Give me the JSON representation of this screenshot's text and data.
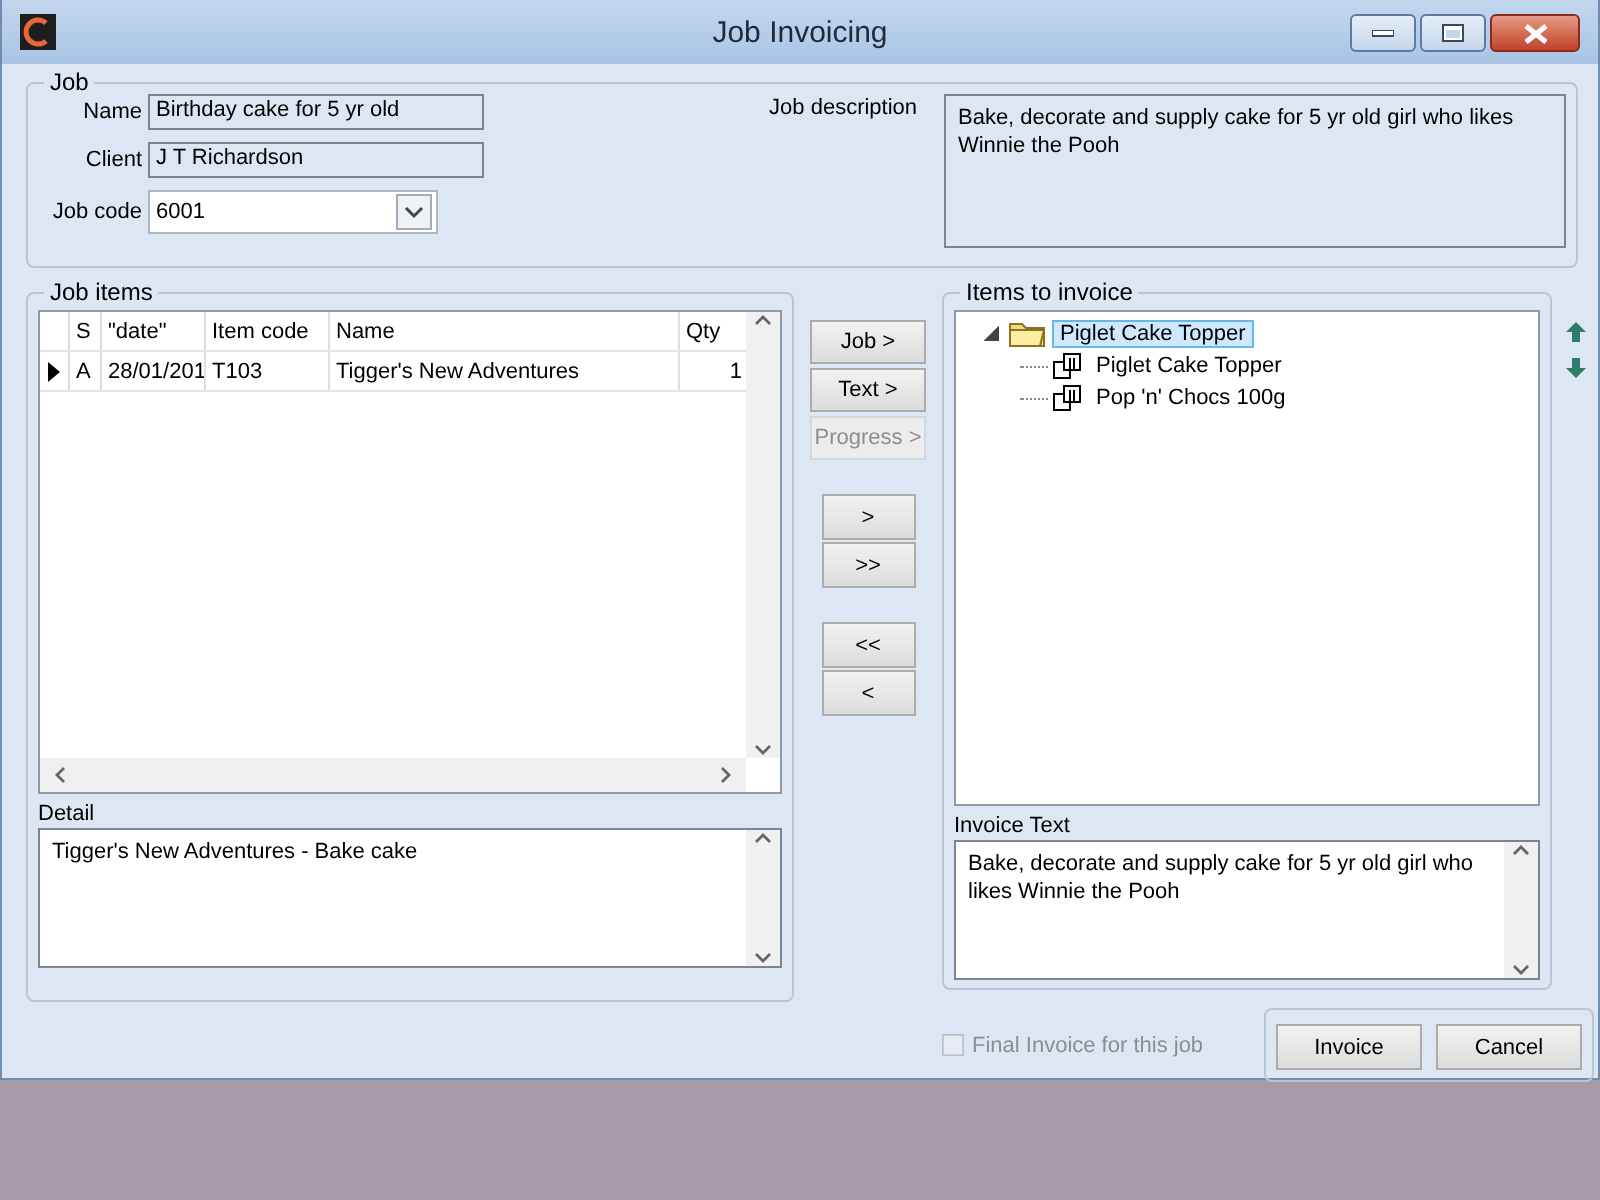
{
  "window": {
    "title": "Job Invoicing"
  },
  "job": {
    "title": "Job",
    "name_label": "Name",
    "name": "Birthday cake for 5 yr old",
    "client_label": "Client",
    "client": "J T Richardson",
    "code_label": "Job code",
    "code": "6001",
    "description_label": "Job description",
    "description": "Bake, decorate and supply cake for 5 yr old girl who likes Winnie the Pooh"
  },
  "job_items": {
    "title": "Job items",
    "columns": [
      "S",
      "\"date\"",
      "Item code",
      "Name",
      "Qty"
    ],
    "rows": [
      {
        "current": true,
        "cells": [
          "A",
          "28/01/201",
          "T103",
          "Tigger's New Adventures",
          "1"
        ]
      }
    ],
    "detail_label": "Detail",
    "detail": "Tigger's New Adventures - Bake cake"
  },
  "transfer_buttons": [
    {
      "label": "Job >",
      "disabled": false
    },
    {
      "label": "Text >",
      "disabled": false
    },
    {
      "label": "Progress >",
      "disabled": true
    }
  ],
  "move_buttons": [
    {
      "label": ">"
    },
    {
      "label": ">>"
    },
    {
      "label": "<<"
    },
    {
      "label": "<"
    }
  ],
  "items_to_invoice": {
    "title": "Items to invoice",
    "tree": [
      {
        "label": "Piglet Cake Topper",
        "expanded": true,
        "selected": true,
        "children": [
          {
            "label": "Piglet Cake Topper",
            "selected": false
          },
          {
            "label": "Pop 'n' Chocs 100g",
            "selected": false
          }
        ]
      }
    ],
    "invoice_text_label": "Invoice Text",
    "invoice_text": "Bake, decorate and supply cake for 5 yr old girl who likes Winnie the Pooh"
  },
  "final_invoice": {
    "label": "Final Invoice for this job",
    "checked": false,
    "disabled": true
  },
  "buttons": [
    "Invoice",
    "Cancel"
  ]
}
